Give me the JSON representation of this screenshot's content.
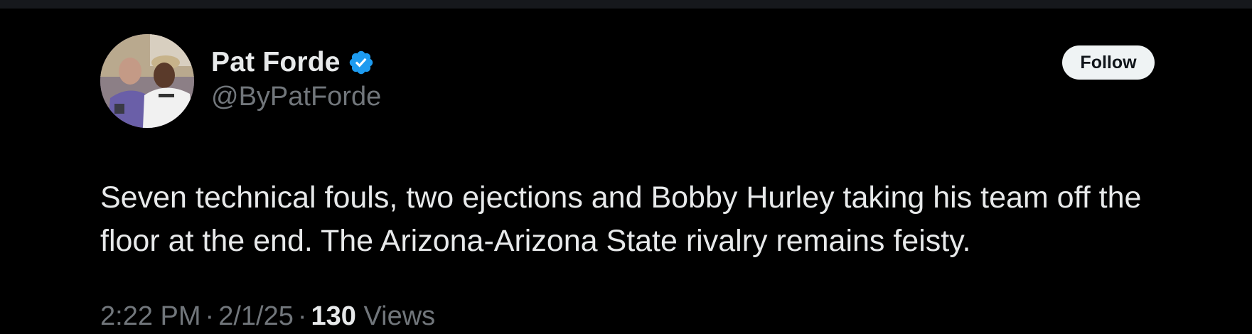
{
  "colors": {
    "background": "#000000",
    "primary_text": "#e7e9ea",
    "secondary_text": "#71767b",
    "verified_badge": "#1d9bf0",
    "follow_button_bg": "#eff3f4",
    "follow_button_text": "#0f1419"
  },
  "author": {
    "display_name": "Pat Forde",
    "handle": "@ByPatForde",
    "verified": true,
    "verified_icon": "verified-badge-icon",
    "avatar": "profile-photo"
  },
  "follow_button": {
    "label": "Follow"
  },
  "tweet": {
    "text": "Seven technical fouls, two ejections and Bobby Hurley taking his team off the floor at the end. The Arizona-Arizona State rivalry remains feisty."
  },
  "meta": {
    "time": "2:22 PM",
    "separator": "·",
    "date": "2/1/25",
    "views_count": "130",
    "views_label": "Views"
  }
}
